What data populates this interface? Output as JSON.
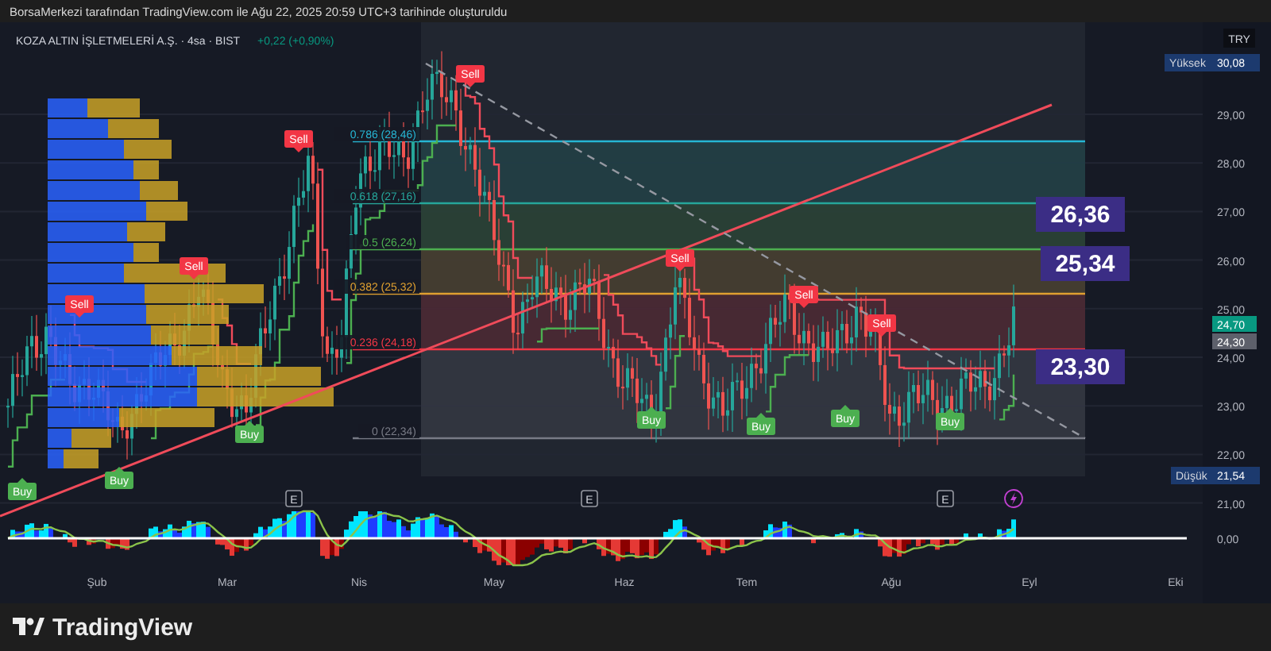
{
  "header": {
    "caption": "BorsaMerkezi tarafından TradingView.com ile Ağu 22, 2025 20:59 UTC+3 tarihinde oluşturuldu"
  },
  "symbol": {
    "name": "KOZA ALTIN İŞLETMELERİ A.Ş. · 4sa · BIST",
    "change": "+0,22 (+0,90%)"
  },
  "price_axis": {
    "currency": "TRY",
    "ticks": [
      "29,00",
      "28,00",
      "27,00",
      "26,00",
      "25,00",
      "24,00",
      "23,00",
      "22,00",
      "21,00"
    ],
    "high": {
      "label": "Yüksek",
      "value": "30,08"
    },
    "low": {
      "label": "Düşük",
      "value": "21,54"
    },
    "last_price": "24,70",
    "prev_price": "24,30",
    "oscillator_zero": "0,00"
  },
  "time_axis": {
    "labels": [
      "Şub",
      "Mar",
      "Nis",
      "May",
      "Haz",
      "Tem",
      "Ağu",
      "Eyl",
      "Eki"
    ]
  },
  "fib_levels": [
    {
      "label": "0.786 (28,46)",
      "color": "#26b6d4"
    },
    {
      "label": "0.618 (27,16)",
      "color": "#26a69a"
    },
    {
      "label": "0.5 (26,24)",
      "color": "#4caf50"
    },
    {
      "label": "0.382 (25,32)",
      "color": "#e0a030"
    },
    {
      "label": "0.236 (24,18)",
      "color": "#f23645"
    },
    {
      "label": "0 (22,34)",
      "color": "#787b86"
    }
  ],
  "targets": [
    "26,36",
    "25,34",
    "23,30"
  ],
  "signals": [
    {
      "kind": "buy",
      "label": "Buy"
    },
    {
      "kind": "sell",
      "label": "Sell"
    },
    {
      "kind": "buy",
      "label": "Buy"
    },
    {
      "kind": "sell",
      "label": "Sell"
    },
    {
      "kind": "buy",
      "label": "Buy"
    },
    {
      "kind": "sell",
      "label": "Sell"
    },
    {
      "kind": "sell",
      "label": "Sell"
    },
    {
      "kind": "buy",
      "label": "Buy"
    },
    {
      "kind": "sell",
      "label": "Sell"
    },
    {
      "kind": "buy",
      "label": "Buy"
    },
    {
      "kind": "sell",
      "label": "Sell"
    },
    {
      "kind": "buy",
      "label": "Buy"
    },
    {
      "kind": "sell",
      "label": "Sell"
    },
    {
      "kind": "buy",
      "label": "Buy"
    }
  ],
  "events": [
    {
      "kind": "earnings",
      "label": "E"
    },
    {
      "kind": "earnings",
      "label": "E"
    },
    {
      "kind": "earnings",
      "label": "E"
    },
    {
      "kind": "news"
    }
  ],
  "footer": {
    "brand": "TradingView"
  }
}
